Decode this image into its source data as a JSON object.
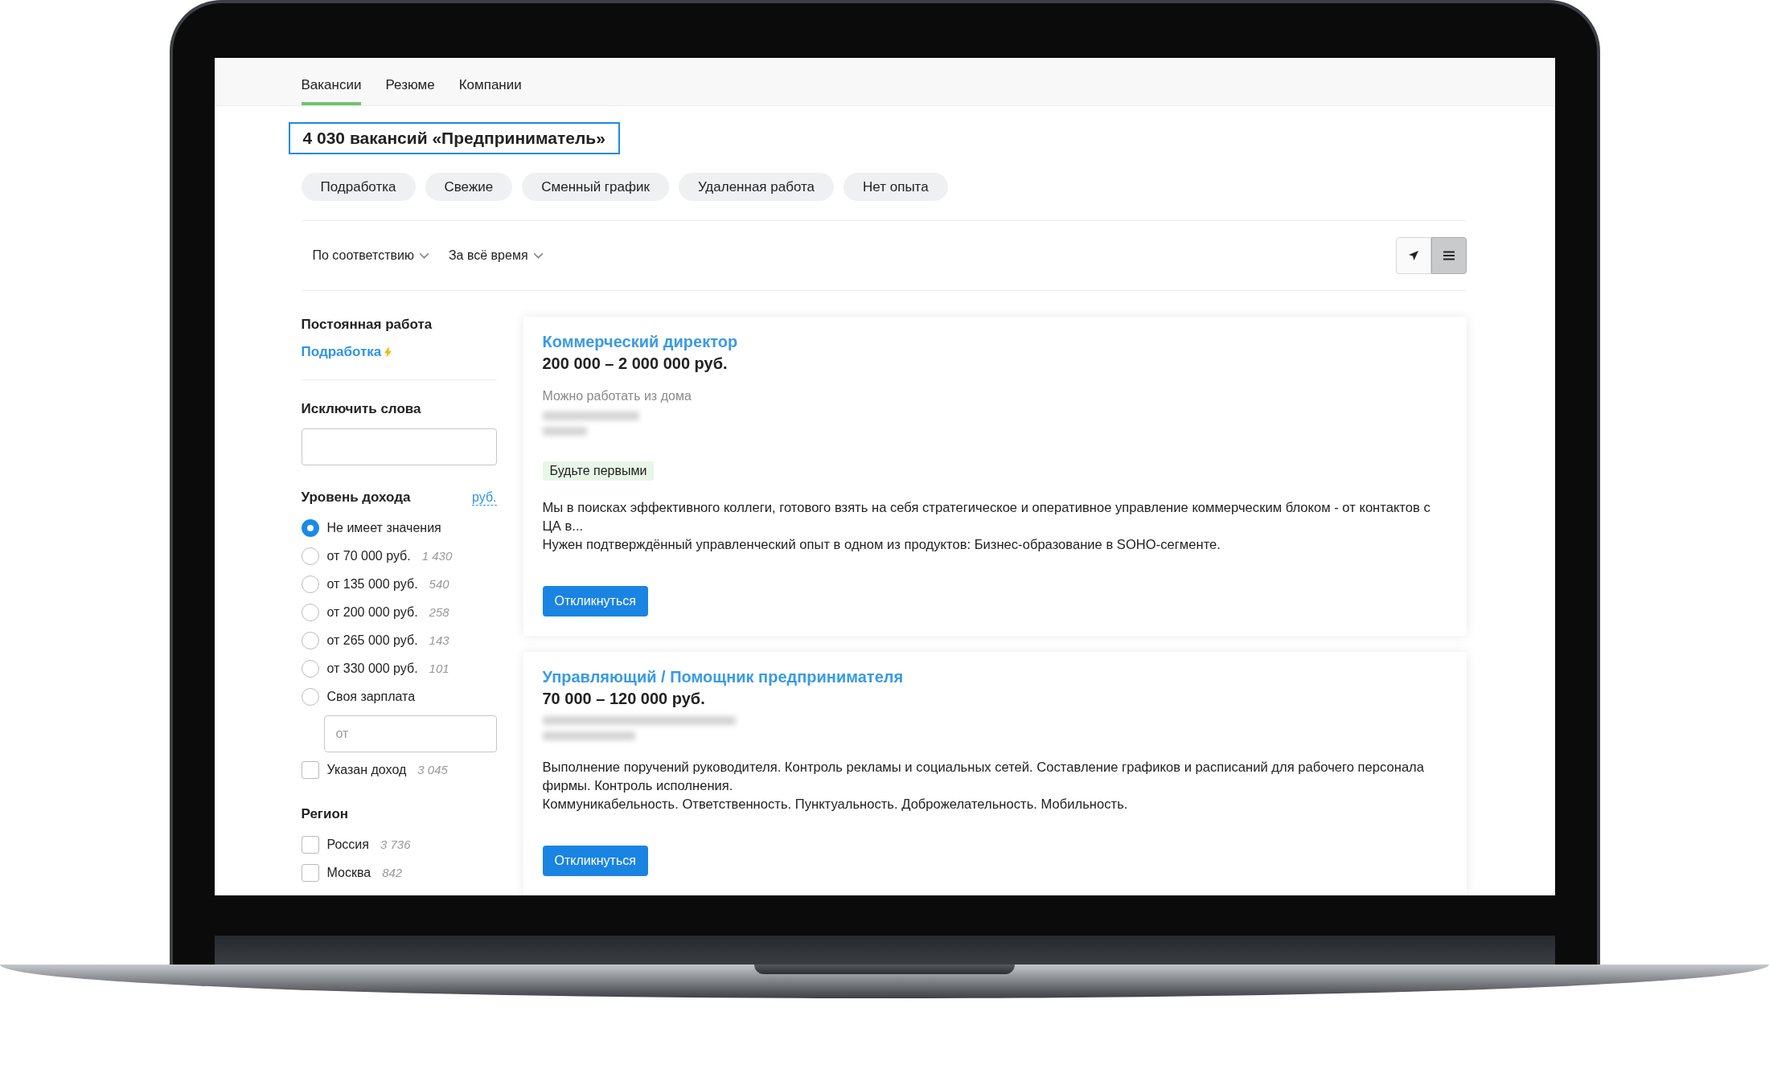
{
  "nav_tabs": [
    {
      "label": "Вакансии",
      "selected": true
    },
    {
      "label": "Резюме",
      "selected": false
    },
    {
      "label": "Компании",
      "selected": false
    }
  ],
  "heading": "4 030 вакансий «Предприниматель»",
  "quick_filters": [
    "Подработка",
    "Свежие",
    "Сменный график",
    "Удаленная работа",
    "Нет опыта"
  ],
  "sort_dropdowns": [
    "По соответствию",
    "За всё время"
  ],
  "view_toggle": [
    {
      "kind": "map",
      "selected": false
    },
    {
      "kind": "list",
      "selected": true
    }
  ],
  "sidebar": {
    "employment": {
      "title": "Постоянная работа",
      "link": "Подработка"
    },
    "exclude_words": {
      "title": "Исключить слова"
    },
    "income": {
      "title": "Уровень дохода",
      "currency": "руб.",
      "options": [
        {
          "label": "Не имеет значения",
          "selected": true
        },
        {
          "label": "от 70 000 руб.",
          "count": "1 430",
          "selected": false
        },
        {
          "label": "от 135 000 руб.",
          "count": "540",
          "selected": false
        },
        {
          "label": "от 200 000 руб.",
          "count": "258",
          "selected": false
        },
        {
          "label": "от 265 000 руб.",
          "count": "143",
          "selected": false
        },
        {
          "label": "от 330 000 руб.",
          "count": "101",
          "selected": false
        },
        {
          "label": "Своя зарплата",
          "selected": false
        }
      ],
      "custom_placeholder": "от",
      "specified": {
        "label": "Указан доход",
        "count": "3 045",
        "checked": false
      }
    },
    "region": {
      "title": "Регион",
      "items": [
        {
          "label": "Россия",
          "count": "3 736",
          "checked": false
        },
        {
          "label": "Москва",
          "count": "842",
          "checked": false
        }
      ]
    }
  },
  "vacancies": [
    {
      "title": "Коммерческий директор",
      "salary": "200 000 – 2 000 000 руб.",
      "note": "Можно работать из дома",
      "badge": "Будьте первыми",
      "description": [
        "Мы в поисках эффективного коллеги, готового взять на себя стратегическое и оперативное управление коммерческим блоком - от контактов с ЦА в...",
        "Нужен подтверждённый управленческий опыт в одном из продуктов: Бизнес-образование в SOHO-сегменте."
      ],
      "button": "Откликнуться"
    },
    {
      "title": "Управляющий / Помощник предпринимателя",
      "salary": "70 000 – 120 000 руб.",
      "description": [
        "Выполнение поручений руководителя. Контроль рекламы и социальных сетей. Составление графиков и расписаний для рабочего персонала фирмы. Контроль исполнения.",
        "Коммуникабельность. Ответственность. Пунктуальность. Доброжелательность. Мобильность."
      ],
      "button": "Откликнуться"
    }
  ]
}
